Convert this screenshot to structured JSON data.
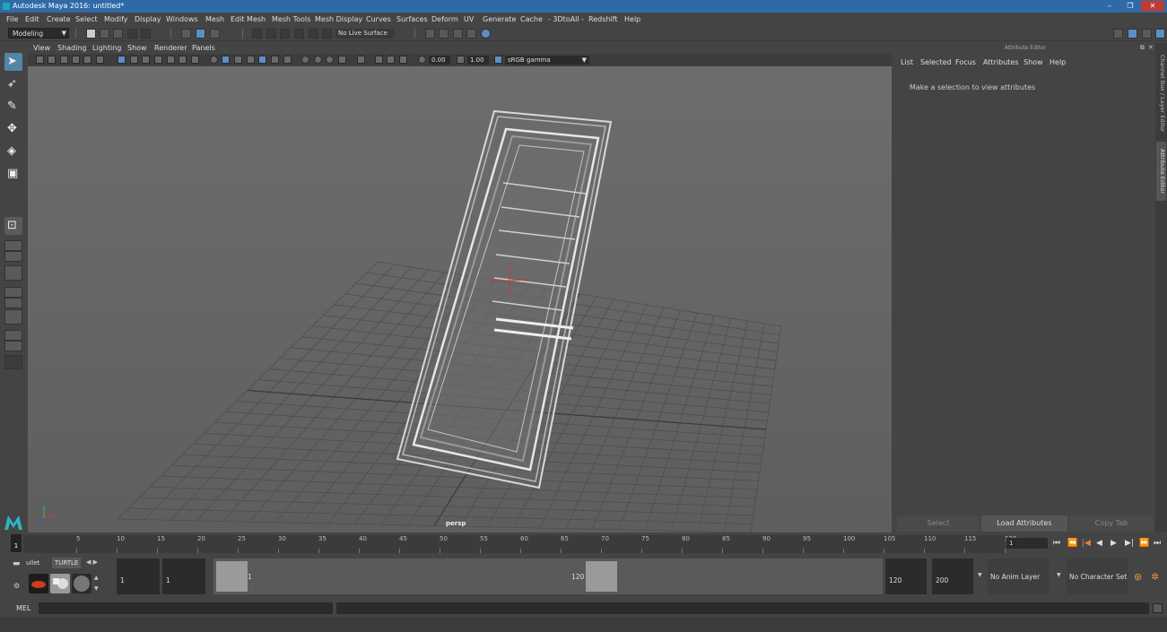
{
  "window": {
    "title": "Autodesk Maya 2016: untitled*",
    "min": "–",
    "max": "❐",
    "close": "✕"
  },
  "menubar": [
    "File",
    "Edit",
    "Create",
    "Select",
    "Modify",
    "Display",
    "Windows",
    "Mesh",
    "Edit Mesh",
    "Mesh Tools",
    "Mesh Display",
    "Curves",
    "Surfaces",
    "Deform",
    "UV",
    "Generate",
    "Cache",
    "- 3DtoAll -",
    "Redshift",
    "Help"
  ],
  "statusline": {
    "mode": "Modeling",
    "mode_arrow": "▼",
    "live_surface": "No Live Surface"
  },
  "viewport": {
    "menu": [
      "View",
      "Shading",
      "Lighting",
      "Show",
      "Renderer",
      "Panels"
    ],
    "exposure": "0.00",
    "gamma": "1.00",
    "color_space": "sRGB gamma",
    "camera_label": "persp"
  },
  "attribute_editor": {
    "title": "Attribute Editor",
    "menu": [
      "List",
      "Selected",
      "Focus",
      "Attributes",
      "Show",
      "Help"
    ],
    "message": "Make a selection to view attributes",
    "buttons": {
      "select": "Select",
      "load": "Load Attributes",
      "copy": "Copy Tab"
    }
  },
  "side_tabs": {
    "channel_box": "Channel Box / Layer Editor",
    "attribute_editor": "Attribute Editor"
  },
  "timeline": {
    "ticks": [
      "5",
      "10",
      "15",
      "20",
      "25",
      "30",
      "35",
      "40",
      "45",
      "50",
      "55",
      "60",
      "65",
      "70",
      "75",
      "80",
      "85",
      "90",
      "95",
      "100",
      "105",
      "110",
      "115",
      "120"
    ],
    "current_frame": "1",
    "frame_field": "1",
    "play_controls": [
      "⏮",
      "⏪",
      "|◀",
      "◀",
      "▶",
      "▶|",
      "⏩",
      "⏭"
    ]
  },
  "shelf": {
    "tabs": [
      "ullet",
      "TURTLE"
    ],
    "arrows": "◀ ▶"
  },
  "range": {
    "start": "1",
    "playback_start": "1",
    "handle_start": "1",
    "handle_end": "120",
    "playback_end": "120",
    "end": "200",
    "anim_layer": "No Anim Layer",
    "character_set": "No Character Set"
  },
  "command_line": {
    "label": "MEL"
  },
  "icons": {
    "select_tool": "select-arrow-icon",
    "lasso_tool": "lasso-icon",
    "paint_tool": "paint-select-icon",
    "move_tool": "move-icon",
    "rotate_tool": "rotate-icon",
    "scale_tool": "scale-icon"
  }
}
